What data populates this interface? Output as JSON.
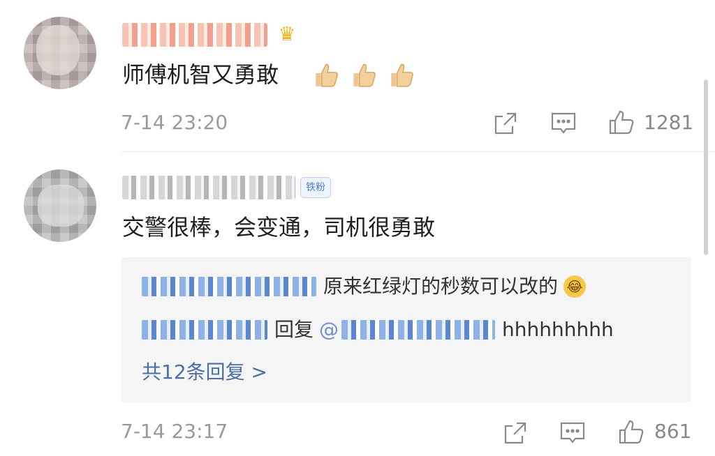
{
  "comments": [
    {
      "text": "师傅机智又勇敢",
      "time": "7-14 23:20",
      "likes": "1281",
      "emoji": [
        "thumbs-up",
        "thumbs-up",
        "thumbs-up"
      ],
      "user_badge_icon": "crown-icon"
    },
    {
      "text": "交警很棒，会变通，司机很勇敢",
      "time": "7-14 23:17",
      "likes": "861",
      "user_badge": "铁粉",
      "replies": [
        {
          "text": "原来红绿灯的秒数可以改的",
          "emoji": "laughing-tears"
        },
        {
          "keyword": "回复",
          "at": "@",
          "text": "hhhhhhhhh"
        }
      ],
      "more_replies": "共12条回复 >"
    }
  ],
  "icons": {
    "share": "share-icon",
    "comment": "comment-icon",
    "like": "thumbs-up-icon"
  },
  "colors": {
    "link_blue": "#4a6ea6",
    "meta_gray": "#9a9a9a",
    "reply_bg": "#f5f5f5"
  }
}
